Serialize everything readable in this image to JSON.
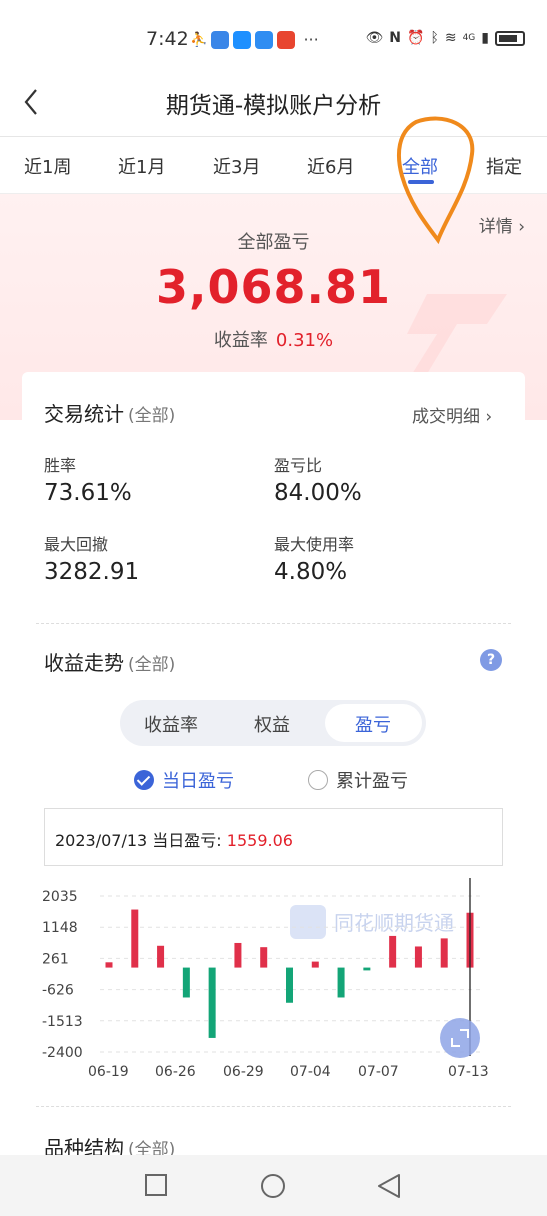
{
  "status": {
    "time": "7:42",
    "more": "···",
    "network": "4G"
  },
  "header": {
    "title": "期货通-模拟账户分析"
  },
  "tabs": [
    {
      "label": "近1周"
    },
    {
      "label": "近1月"
    },
    {
      "label": "近3月"
    },
    {
      "label": "近6月"
    },
    {
      "label": "全部"
    },
    {
      "label": "指定"
    }
  ],
  "hero": {
    "detail_link": "详情 ›",
    "label": "全部盈亏",
    "value": "3,068.81",
    "rate_label": "收益率",
    "rate_value": "0.31%"
  },
  "trade_stats": {
    "title": "交易统计",
    "sub": "(全部)",
    "link": "成交明细 ›",
    "items": [
      {
        "label": "胜率",
        "value": "73.61%"
      },
      {
        "label": "盈亏比",
        "value": "84.00%"
      },
      {
        "label": "最大回撤",
        "value": "3282.91"
      },
      {
        "label": "最大使用率",
        "value": "4.80%"
      }
    ]
  },
  "trend": {
    "title": "收益走势",
    "sub": "(全部)",
    "help": "?",
    "segments": [
      "收益率",
      "权益",
      "盈亏"
    ],
    "active_segment": "盈亏",
    "radio_daily": "当日盈亏",
    "radio_cumulative": "累计盈亏",
    "tooltip_label": "2023/07/13 当日盈亏:",
    "tooltip_value": "1559.06",
    "watermark": "同花顺期货通"
  },
  "chart_data": {
    "type": "bar",
    "y_ticks": [
      "2035",
      "1148",
      "261",
      "-626",
      "-1513",
      "-2400"
    ],
    "ylim": [
      -2400,
      2035
    ],
    "x_ticks": [
      "06-19",
      "06-26",
      "06-29",
      "07-04",
      "07-07",
      "07-13"
    ],
    "grid": true,
    "values": [
      150,
      1650,
      620,
      -850,
      -2000,
      700,
      580,
      -1000,
      170,
      -850,
      -80,
      900,
      600,
      830,
      1559.06
    ],
    "positive_color": "#e0304a",
    "negative_color": "#13a577"
  },
  "structure": {
    "title": "品种结构",
    "sub": "(全部)"
  },
  "colors": {
    "accent": "#3b64d8",
    "profit": "#e2212b",
    "loss": "#13a577"
  }
}
